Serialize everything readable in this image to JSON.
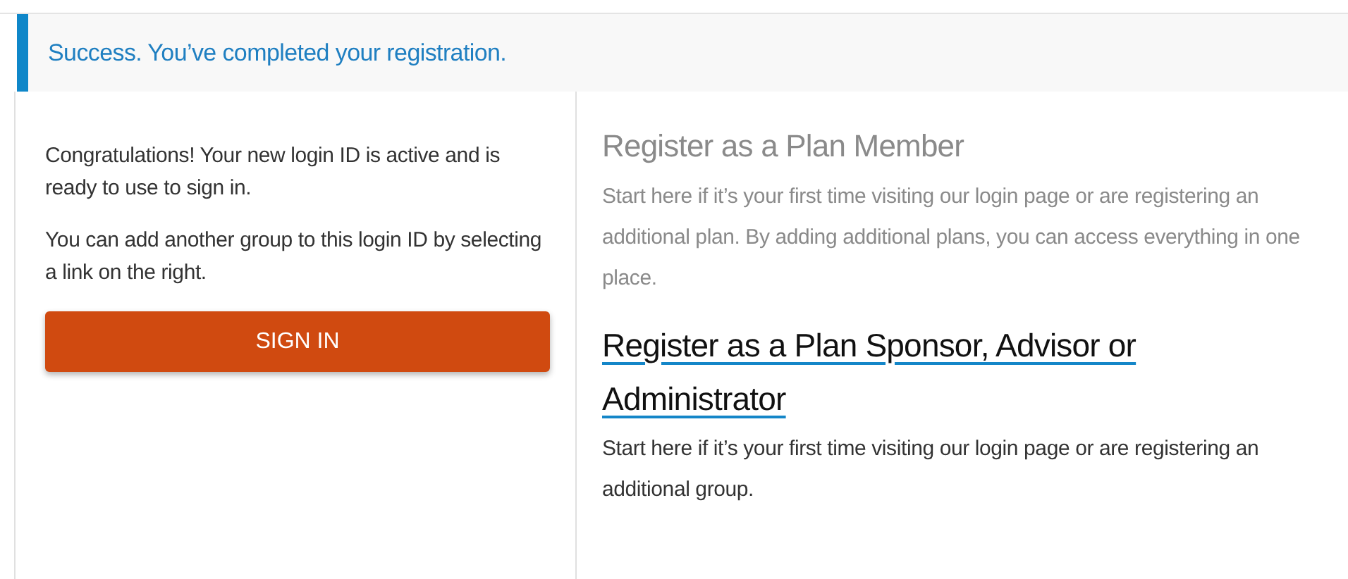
{
  "alert": {
    "message": "Success. You’ve completed your registration."
  },
  "confirmation": {
    "paragraphs": [
      "Congratulations! Your new login ID is active and is ready to use to sign in.",
      "You can add another group to this login ID by selecting a link on the right."
    ],
    "button": "SIGN IN"
  },
  "options": [
    {
      "title": "Register as a Plan Member",
      "description": "Start here if it’s your first time visiting our login page or are registering an additional plan. By adding additional plans, you can access everything in one place.",
      "disabled": true
    },
    {
      "title": "Register as a Plan Sponsor, Advisor or Administrator",
      "description": "Start here if it’s your first time visiting our login page or are registering an additional group.",
      "disabled": false
    }
  ]
}
